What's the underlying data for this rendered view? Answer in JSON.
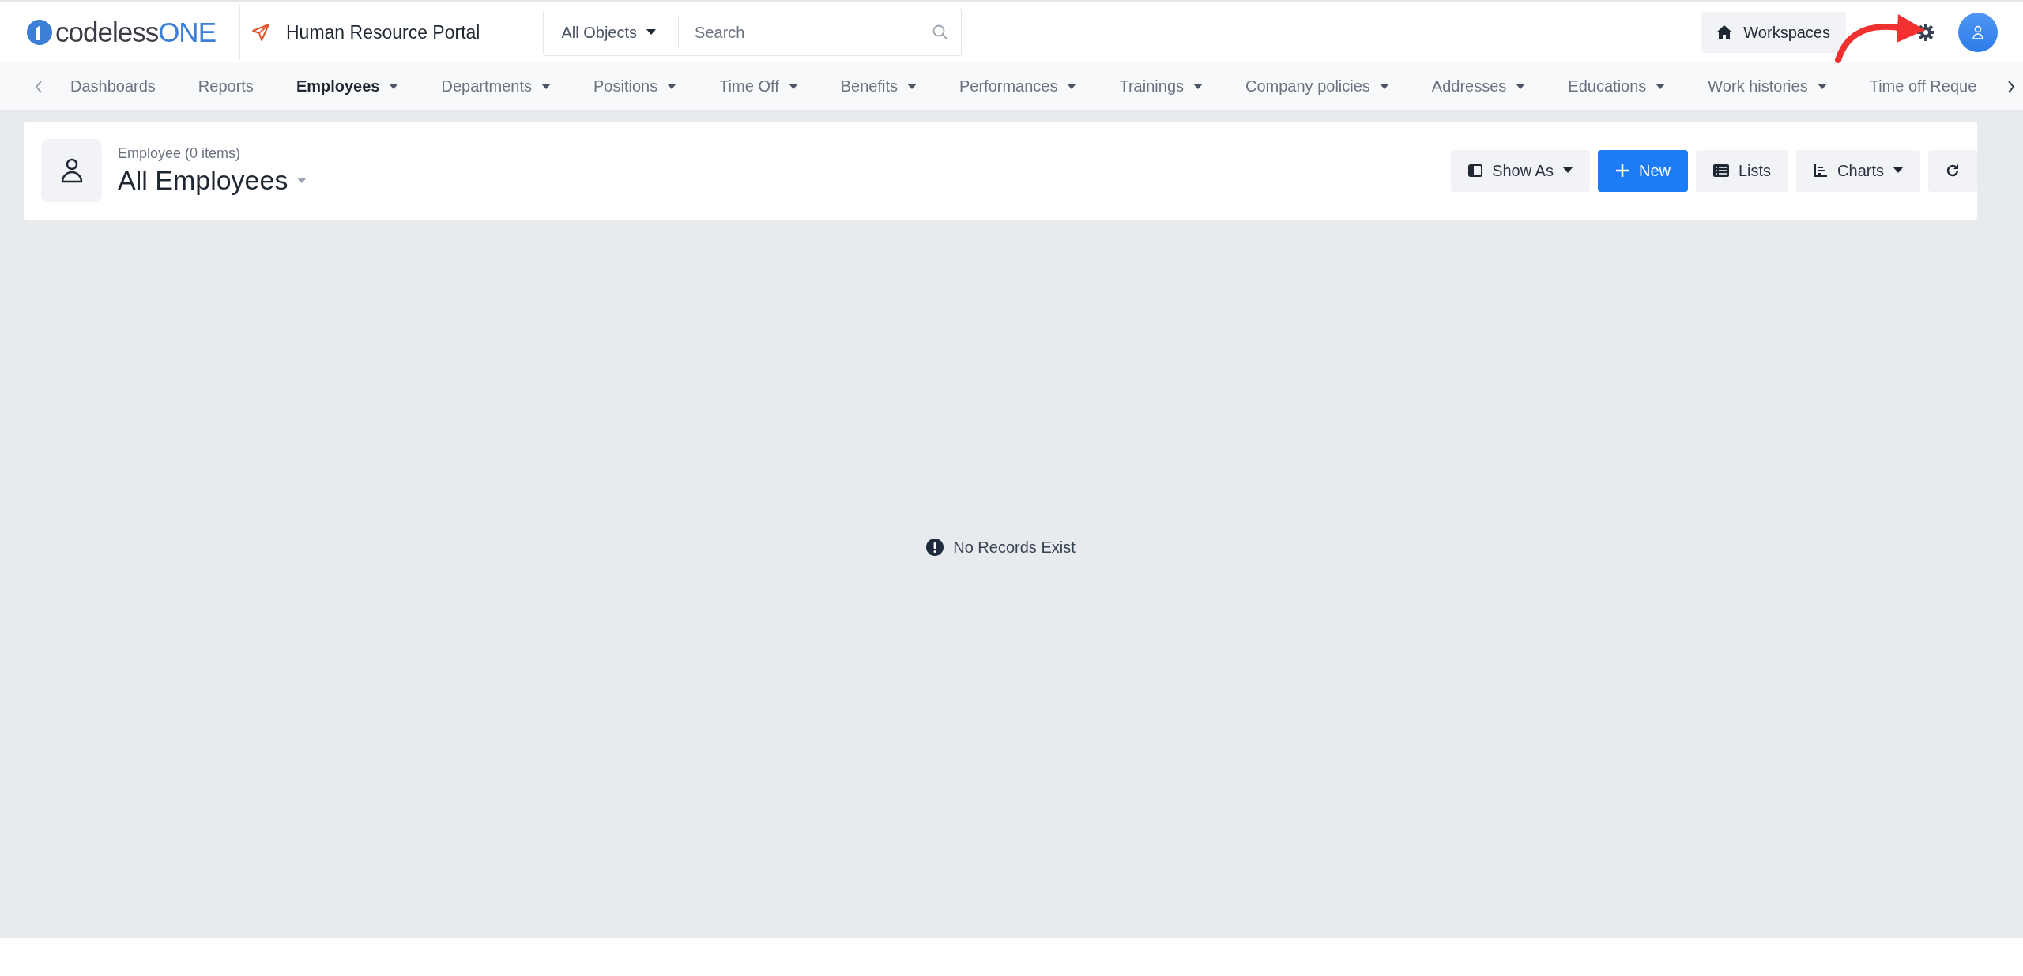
{
  "header": {
    "logo": {
      "prefix": "codeless",
      "suffix": "ONE"
    },
    "app_title": "Human Resource Portal",
    "search": {
      "scope": "All Objects",
      "placeholder": "Search"
    },
    "workspaces_button": "Workspaces"
  },
  "nav": {
    "items": [
      {
        "label": "Dashboards",
        "has_menu": false,
        "selected": false
      },
      {
        "label": "Reports",
        "has_menu": false,
        "selected": false
      },
      {
        "label": "Employees",
        "has_menu": true,
        "selected": true
      },
      {
        "label": "Departments",
        "has_menu": true,
        "selected": false
      },
      {
        "label": "Positions",
        "has_menu": true,
        "selected": false
      },
      {
        "label": "Time Off",
        "has_menu": true,
        "selected": false
      },
      {
        "label": "Benefits",
        "has_menu": true,
        "selected": false
      },
      {
        "label": "Performances",
        "has_menu": true,
        "selected": false
      },
      {
        "label": "Trainings",
        "has_menu": true,
        "selected": false
      },
      {
        "label": "Company policies",
        "has_menu": true,
        "selected": false
      },
      {
        "label": "Addresses",
        "has_menu": true,
        "selected": false
      },
      {
        "label": "Educations",
        "has_menu": true,
        "selected": false
      },
      {
        "label": "Work histories",
        "has_menu": true,
        "selected": false
      },
      {
        "label": "Time off Reque",
        "has_menu": false,
        "selected": false
      }
    ]
  },
  "list_header": {
    "subtitle": "Employee (0 items)",
    "title": "All Employees",
    "buttons": [
      {
        "kind": "showas",
        "label": "Show As",
        "has_menu": true
      },
      {
        "kind": "new",
        "label": "New",
        "has_menu": false
      },
      {
        "kind": "lists",
        "label": "Lists",
        "has_menu": false
      },
      {
        "kind": "charts",
        "label": "Charts",
        "has_menu": true
      },
      {
        "kind": "refresh",
        "has_menu": false
      }
    ]
  },
  "empty_state": {
    "message": "No Records Exist"
  }
}
